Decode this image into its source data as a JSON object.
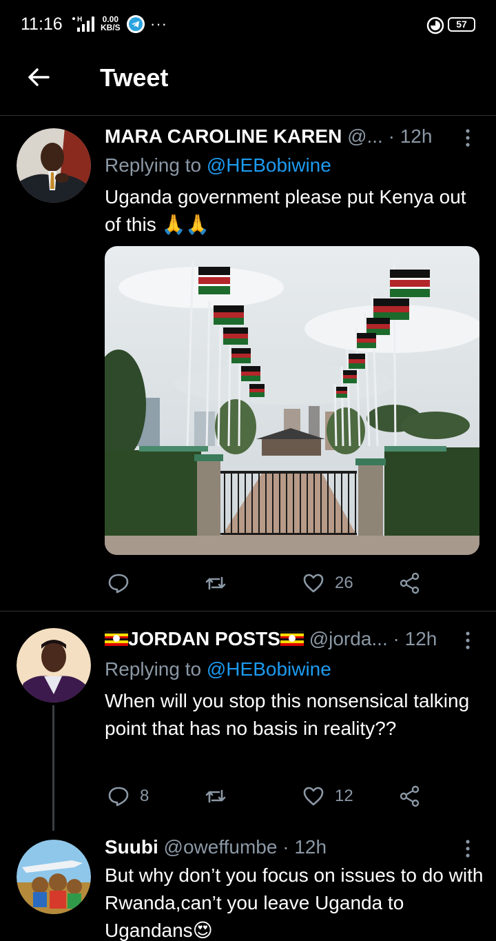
{
  "status_bar": {
    "time": "11:16",
    "net_speed_value": "0.00",
    "net_speed_unit": "KB/S",
    "signal_label": "H",
    "more": "···",
    "battery": "57"
  },
  "header": {
    "title": "Tweet"
  },
  "tweets": [
    {
      "name": "MARA CAROLINE KAREN",
      "handle": " @...",
      "time": " · 12h",
      "replying_prefix": "Replying to ",
      "replying_handle": "@HEBobiwine",
      "text": "Uganda government please put Kenya out of this 🙏🙏",
      "actions": {
        "reply_count": "",
        "retweet_count": "",
        "like_count": "26"
      }
    },
    {
      "name": "JORDAN POSTS",
      "handle": " @jorda...",
      "time": " · 12h",
      "replying_prefix": "Replying to ",
      "replying_handle": "@HEBobiwine",
      "text": "When will you stop this nonsensical talking point that has no basis in reality??",
      "actions": {
        "reply_count": "8",
        "retweet_count": "",
        "like_count": "12"
      }
    },
    {
      "name": "Suubi",
      "handle": " @oweffumbe",
      "time": " · 12h",
      "text": "But why don’t you focus on issues to do with Rwanda,can’t you leave Uganda to Ugandans😍"
    }
  ],
  "colors": {
    "accent": "#1d9bf0",
    "muted": "#8b98a5",
    "background": "#000000"
  }
}
